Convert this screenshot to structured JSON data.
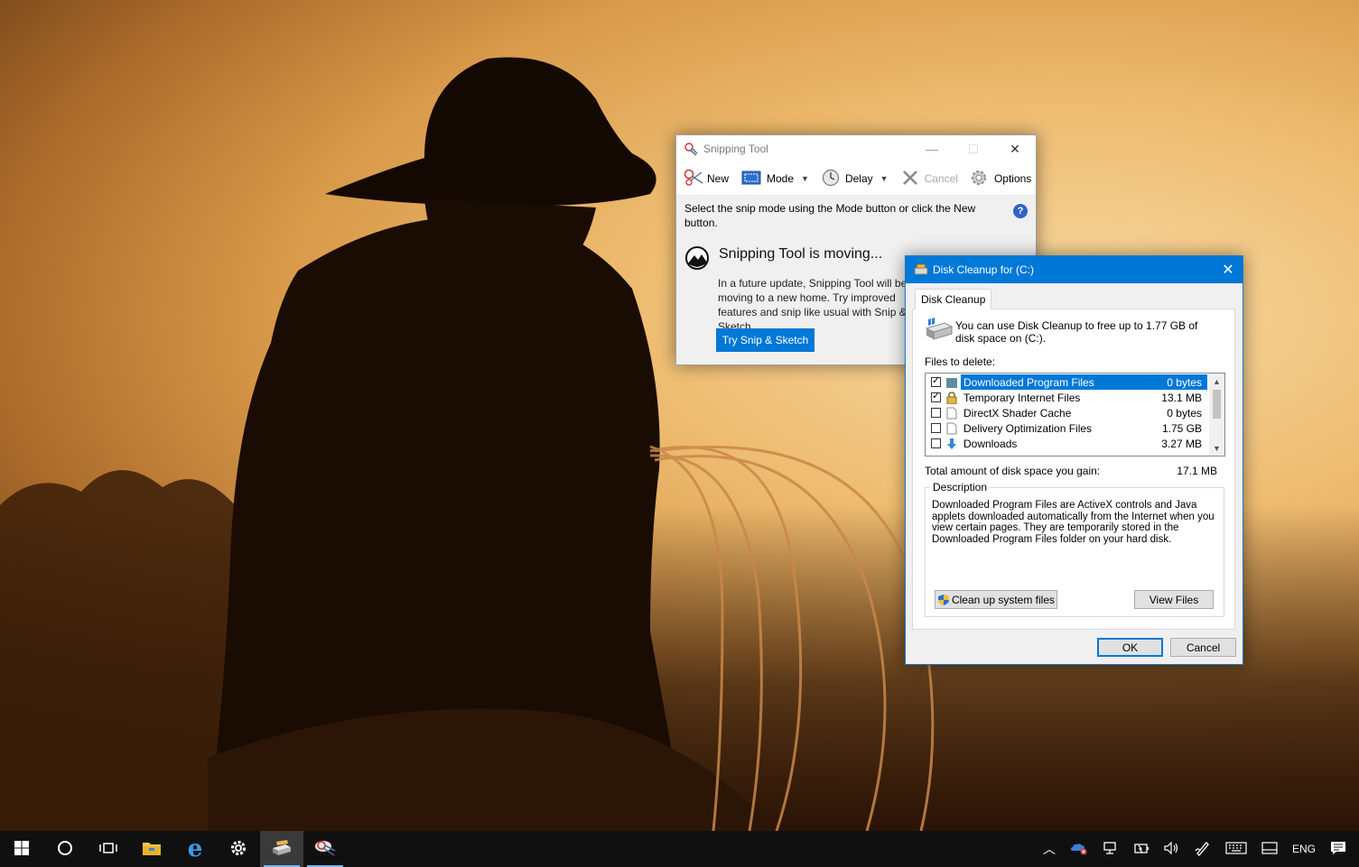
{
  "snipping_tool": {
    "title": "Snipping Tool",
    "toolbar": {
      "new_label": "New",
      "mode_label": "Mode",
      "delay_label": "Delay",
      "cancel_label": "Cancel",
      "options_label": "Options"
    },
    "hint": "Select the snip mode using the Mode button or click the New button.",
    "moving_title": "Snipping Tool is moving...",
    "moving_body": "In a future update, Snipping Tool will be moving to a new home. Try improved features and snip like usual with Snip & Sketch.",
    "try_button": "Try Snip & Sketch"
  },
  "disk_cleanup": {
    "title": "Disk Cleanup for  (C:)",
    "tab": "Disk Cleanup",
    "intro": "You can use Disk Cleanup to free up to 1.77 GB of disk space on  (C:).",
    "files_label": "Files to delete:",
    "files": [
      {
        "name": "Downloaded Program Files",
        "size": "0 bytes",
        "checked": true,
        "selected": true,
        "icon": "folder-icon"
      },
      {
        "name": "Temporary Internet Files",
        "size": "13.1 MB",
        "checked": true,
        "selected": false,
        "icon": "lock-icon"
      },
      {
        "name": "DirectX Shader Cache",
        "size": "0 bytes",
        "checked": false,
        "selected": false,
        "icon": "file-icon"
      },
      {
        "name": "Delivery Optimization Files",
        "size": "1.75 GB",
        "checked": false,
        "selected": false,
        "icon": "file-icon"
      },
      {
        "name": "Downloads",
        "size": "3.27 MB",
        "checked": false,
        "selected": false,
        "icon": "download-icon"
      }
    ],
    "total_label": "Total amount of disk space you gain:",
    "total_value": "17.1 MB",
    "description_legend": "Description",
    "description_text": "Downloaded Program Files are ActiveX controls and Java applets downloaded automatically from the Internet when you view certain pages. They are temporarily stored in the Downloaded Program Files folder on your hard disk.",
    "cleanup_system_button": "Clean up system files",
    "view_files_button": "View Files",
    "ok_button": "OK",
    "cancel_button": "Cancel"
  },
  "taskbar": {
    "language": "ENG"
  },
  "colors": {
    "accent": "#0078d7",
    "taskbar": "#101010"
  }
}
